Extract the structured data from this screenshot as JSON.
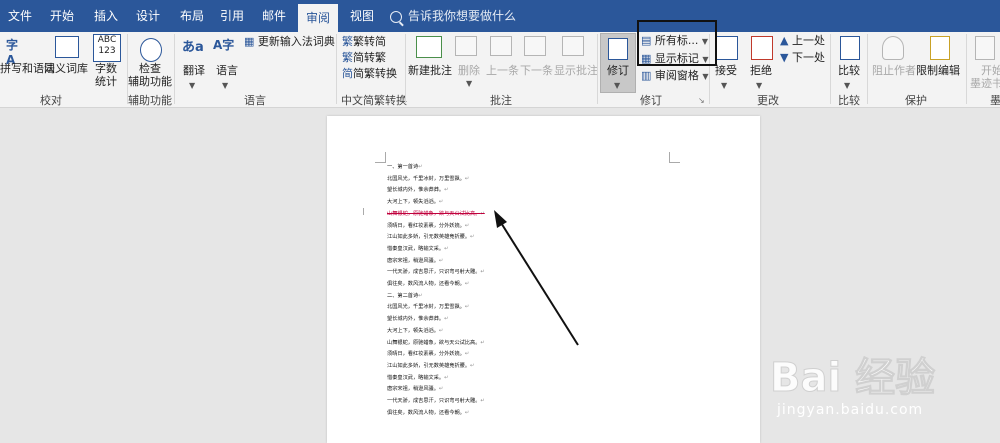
{
  "tabs": [
    "文件",
    "开始",
    "插入",
    "设计",
    "布局",
    "引用",
    "邮件",
    "审阅",
    "视图"
  ],
  "active_tab": "审阅",
  "tell_me_placeholder": "告诉我你想要做什么",
  "ribbon": {
    "proofing": {
      "spell": "拼写和语法",
      "thesaurus": "同义词库",
      "wordcount_icon": "ABC\n123",
      "wordcount": "字数\n统计",
      "label": "校对"
    },
    "accessibility": {
      "check": "检查\n辅助功能",
      "label": "辅助功能"
    },
    "language": {
      "translate": "翻译",
      "language": "语言",
      "update_ime": "更新输入法词典",
      "label": "语言"
    },
    "chinese": {
      "to_simplified": "繁转简",
      "to_traditional": "简转繁",
      "convert": "简繁转换",
      "label": "中文简繁转换"
    },
    "comments": {
      "new": "新建批注",
      "delete": "删除",
      "prev": "上一条",
      "next": "下一条",
      "show": "显示批注",
      "label": "批注"
    },
    "tracking": {
      "track": "修订",
      "markup_select": "所有标...",
      "show_markup": "显示标记",
      "review_pane": "审阅窗格",
      "label": "修订"
    },
    "changes": {
      "accept": "接受",
      "reject": "拒绝",
      "prev": "上一处",
      "next": "下一处",
      "label": "更改"
    },
    "compare": {
      "compare": "比较",
      "label": "比较"
    },
    "protect": {
      "block_authors": "阻止作者",
      "restrict": "限制编辑",
      "label": "保护"
    },
    "ink": {
      "start_ink": "开始\n墨迹书写",
      "label": "墨"
    }
  },
  "document_lines": [
    {
      "text": "一、第一首诗",
      "deleted": false
    },
    {
      "text": "北国风光，千里冰封，万里雪飘。",
      "deleted": false
    },
    {
      "text": "望长城内外，惟余莽莽。",
      "deleted": false
    },
    {
      "text": "大河上下，顿失滔滔。",
      "deleted": false
    },
    {
      "text": "山舞银蛇，原驰蜡象，欲与天公试比高。",
      "deleted": true
    },
    {
      "text": "须晴日，看红妆素裹，分外妖娆。",
      "deleted": false
    },
    {
      "text": "江山如此多娇，引无数英雄竞折腰。",
      "deleted": false
    },
    {
      "text": "惜秦皇汉武，略输文采。",
      "deleted": false
    },
    {
      "text": "唐宗宋祖，稍逊风骚。",
      "deleted": false
    },
    {
      "text": "一代天骄，成吉思汗，只识弯弓射大雕。",
      "deleted": false
    },
    {
      "text": "俱往矣，数风流人物，还看今朝。",
      "deleted": false
    },
    {
      "text": "二、第二首诗",
      "deleted": false
    },
    {
      "text": "北国风光，千里冰封，万里雪飘。",
      "deleted": false
    },
    {
      "text": "望长城内外，惟余莽莽。",
      "deleted": false
    },
    {
      "text": "大河上下，顿失滔滔。",
      "deleted": false
    },
    {
      "text": "山舞银蛇，原驰蜡象，欲与天公试比高。",
      "deleted": false
    },
    {
      "text": "须晴日，看红妆素裹，分外妖娆。",
      "deleted": false
    },
    {
      "text": "江山如此多娇，引无数英雄竞折腰。",
      "deleted": false
    },
    {
      "text": "惜秦皇汉武，略输文采。",
      "deleted": false
    },
    {
      "text": "唐宗宋祖，稍逊风骚。",
      "deleted": false
    },
    {
      "text": "一代天骄，成吉思汗，只识弯弓射大雕。",
      "deleted": false
    },
    {
      "text": "俱往矣，数风流人物，还看今朝。",
      "deleted": false
    }
  ],
  "watermark": {
    "logo": "Bai 经验",
    "url": "jingyan.baidu.com"
  },
  "colors": {
    "title_bar": "#2b579a",
    "ribbon_bg": "#f3f3f3",
    "workspace": "#e6e6e6",
    "deleted_text": "#c0003c"
  }
}
